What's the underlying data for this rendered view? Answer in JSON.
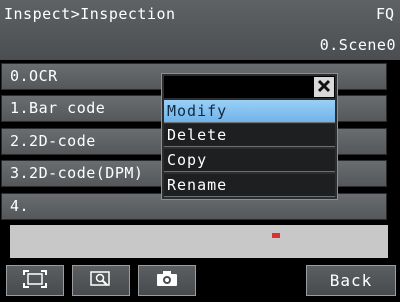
{
  "header": {
    "breadcrumb": "Inspect>Inspection",
    "device": "FQ",
    "scene": "0.Scene0"
  },
  "items": [
    {
      "label": "0.OCR"
    },
    {
      "label": "1.Bar code"
    },
    {
      "label": "2.2D-code"
    },
    {
      "label": "3.2D-code(DPM)"
    },
    {
      "label": "4."
    }
  ],
  "context_menu": {
    "close_icon": "close-x-icon",
    "options": [
      {
        "label": "Modify",
        "selected": true
      },
      {
        "label": "Delete",
        "selected": false
      },
      {
        "label": "Copy",
        "selected": false
      },
      {
        "label": "Rename",
        "selected": false
      }
    ]
  },
  "bottom_bar": {
    "tools": [
      "frame-icon",
      "zoom-icon",
      "camera-icon"
    ],
    "back_label": "Back"
  },
  "colors": {
    "header_bg": "#55585b",
    "item_bg": "#606366",
    "selected_bg": "#8cc6f2",
    "preview_bg": "#c8c8c8",
    "marker": "#d9332f"
  }
}
